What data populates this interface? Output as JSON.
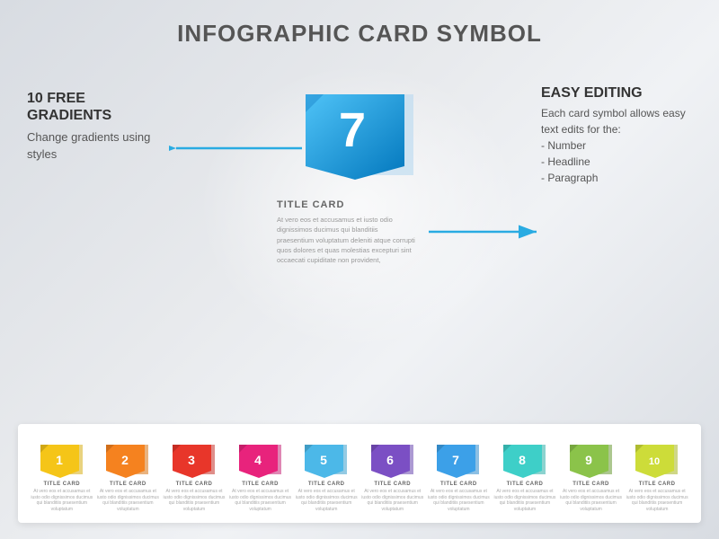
{
  "title": "INFOGRAPHIC CARD SYMBOL",
  "left_annotation": {
    "title": "10 FREE\nGRADIENTS",
    "description": "Change gradients using styles"
  },
  "right_annotation": {
    "title": "EASY EDITING",
    "description": "Each card symbol allows easy text edits for the:\n- Number\n- Headline\n- Paragraph"
  },
  "center_card": {
    "number": "7",
    "title": "TITLE CARD",
    "paragraph": "At vero eos et accusamus et iusto odio dignissimos ducimus qui blanditiis praesentium voluptatum deleniti atque corrupti quos dolores et quas molestias excepturi sint occaecati cupiditate non provident,"
  },
  "cards": [
    {
      "number": "1",
      "color": "#f5c518",
      "shadow": "#d4a800",
      "title": "TITLE CARD"
    },
    {
      "number": "2",
      "color": "#f5821f",
      "shadow": "#d46800",
      "title": "TITLE CARD"
    },
    {
      "number": "3",
      "color": "#e8362a",
      "shadow": "#c01e15",
      "title": "TITLE CARD"
    },
    {
      "number": "4",
      "color": "#e8237c",
      "shadow": "#c0106a",
      "title": "TITLE CARD"
    },
    {
      "number": "5",
      "color": "#4cb8e8",
      "shadow": "#2a96c8",
      "title": "TITLE CARD"
    },
    {
      "number": "6",
      "color": "#7b4fc4",
      "shadow": "#5a35a8",
      "title": "TITLE CARD"
    },
    {
      "number": "7",
      "color": "#3ca0e8",
      "shadow": "#1a80c8",
      "title": "TITLE CARD"
    },
    {
      "number": "8",
      "color": "#3ecfc8",
      "shadow": "#1aa8a0",
      "title": "TITLE CARD"
    },
    {
      "number": "9",
      "color": "#8bc34a",
      "shadow": "#5a9020",
      "title": "TITLE CARD"
    },
    {
      "number": "10",
      "color": "#cddc39",
      "shadow": "#a0b010",
      "title": "TITLE CARD"
    }
  ],
  "card_text": "At vero eos et accusamus et iusto odio dignissimos ducimus qui blanditiis praesentium voluptatum"
}
